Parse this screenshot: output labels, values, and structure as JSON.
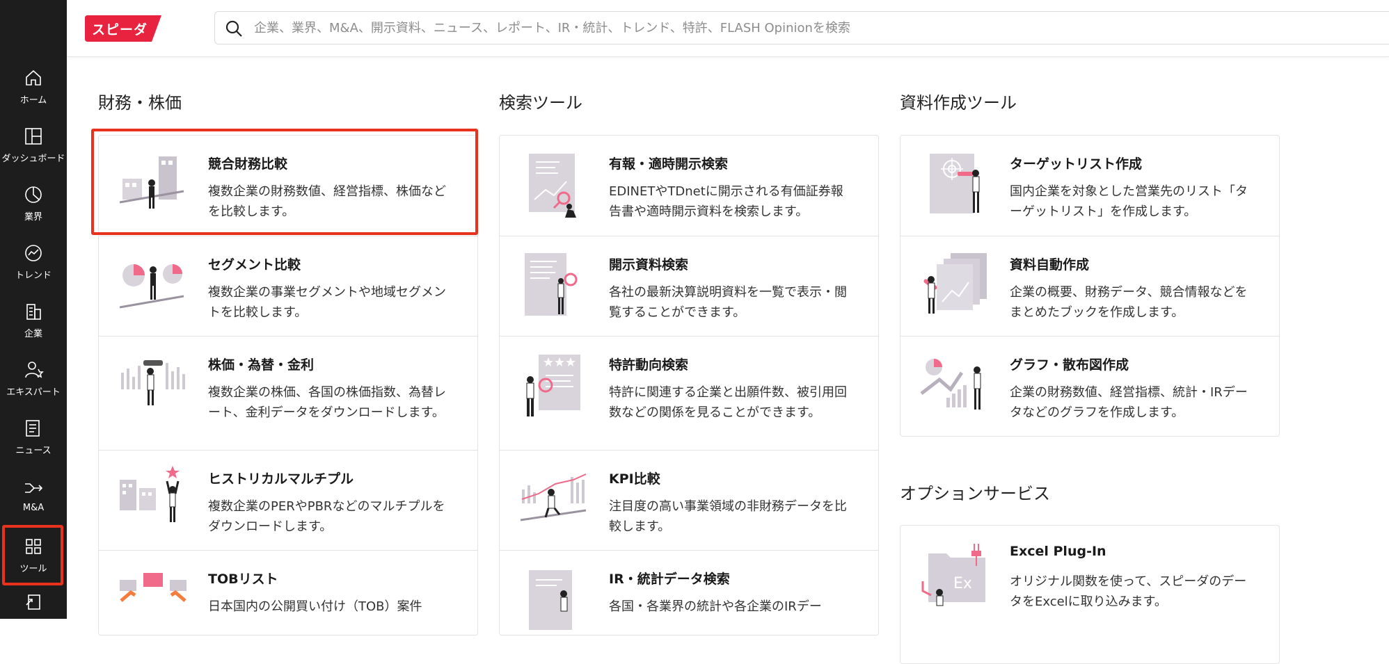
{
  "brand": {
    "logo_text": "スピーダ",
    "accent": "#e8233f",
    "highlight": "#e8321e"
  },
  "search": {
    "placeholder": "企業、業界、M&A、開示資料、ニュース、レポート、IR・統計、トレンド、特許、FLASH Opinionを検索"
  },
  "sidebar": {
    "items": [
      {
        "label": "ホーム",
        "icon": "home-icon"
      },
      {
        "label": "ダッシュボード",
        "icon": "dashboard-icon"
      },
      {
        "label": "業界",
        "icon": "industry-pie-icon"
      },
      {
        "label": "トレンド",
        "icon": "trend-icon"
      },
      {
        "label": "企業",
        "icon": "building-icon"
      },
      {
        "label": "エキスパート",
        "icon": "expert-icon"
      },
      {
        "label": "ニュース",
        "icon": "news-icon"
      },
      {
        "label": "M&A",
        "icon": "merger-icon"
      },
      {
        "label": "ツール",
        "icon": "tools-grid-icon",
        "active": true
      }
    ]
  },
  "sections": [
    {
      "title": "財務・株価",
      "cards": [
        {
          "title": "競合財務比較",
          "desc": "複数企業の財務数値、経営指標、株価などを比較します。",
          "icon": "finance-compare-illustration"
        },
        {
          "title": "セグメント比較",
          "desc": "複数企業の事業セグメントや地域セグメントを比較します。",
          "icon": "segment-compare-illustration"
        },
        {
          "title": "株価・為替・金利",
          "desc": "複数企業の株価、各国の株価指数、為替レート、金利データをダウンロードします。",
          "icon": "stock-fx-illustration"
        },
        {
          "title": "ヒストリカルマルチプル",
          "desc": "複数企業のPERやPBRなどのマルチプルをダウンロードします。",
          "icon": "historical-multiple-illustration"
        },
        {
          "title": "TOBリスト",
          "desc": "日本国内の公開買い付け（TOB）案件",
          "icon": "tob-list-illustration"
        }
      ]
    },
    {
      "title": "検索ツール",
      "cards": [
        {
          "title": "有報・適時開示検索",
          "desc": "EDINETやTDnetに開示される有価証券報告書や適時開示資料を検索します。",
          "icon": "filing-search-illustration"
        },
        {
          "title": "開示資料検索",
          "desc": "各社の最新決算説明資料を一覧で表示・閲覧することができます。",
          "icon": "disclosure-search-illustration"
        },
        {
          "title": "特許動向検索",
          "desc": "特許に関連する企業と出願件数、被引用回数などの関係を見ることができます。",
          "icon": "patent-search-illustration"
        },
        {
          "title": "KPI比較",
          "desc": "注目度の高い事業領域の非財務データを比較します。",
          "icon": "kpi-compare-illustration"
        },
        {
          "title": "IR・統計データ検索",
          "desc": "各国・各業界の統計や各企業のIRデー",
          "icon": "ir-stats-illustration"
        }
      ]
    },
    {
      "title": "資料作成ツール",
      "cards": [
        {
          "title": "ターゲットリスト作成",
          "desc": "国内企業を対象とした営業先のリスト「ターゲットリスト」を作成します。",
          "icon": "target-list-illustration"
        },
        {
          "title": "資料自動作成",
          "desc": "企業の概要、財務データ、競合情報などをまとめたブックを作成します。",
          "icon": "auto-document-illustration"
        },
        {
          "title": "グラフ・散布図作成",
          "desc": "企業の財務数値、経営指標、統計・IRデータなどのグラフを作成します。",
          "icon": "graph-scatter-illustration"
        }
      ]
    },
    {
      "title": "オプションサービス",
      "cards": [
        {
          "title": "Excel Plug-In",
          "desc": "オリジナル関数を使って、スピーダのデータをExcelに取り込みます。",
          "icon": "excel-plugin-illustration",
          "badge": "Ex"
        }
      ]
    }
  ]
}
